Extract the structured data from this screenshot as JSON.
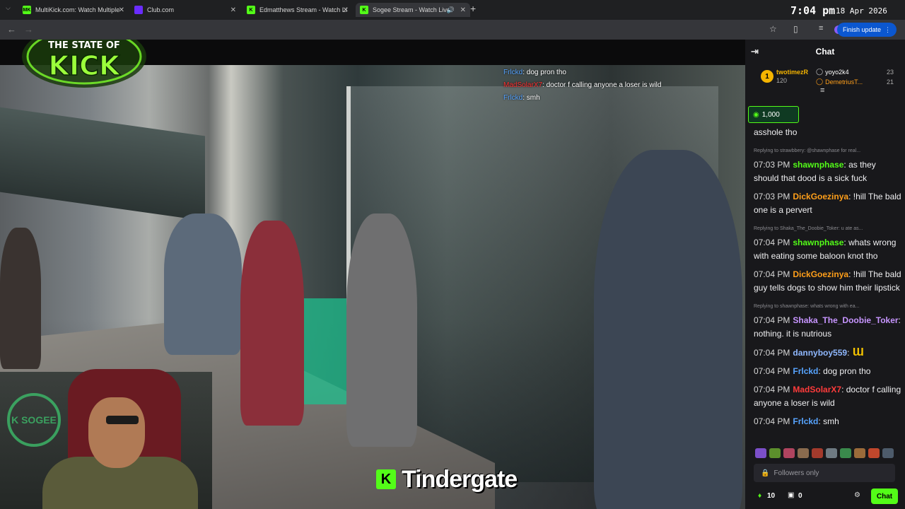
{
  "browser": {
    "tabs": [
      {
        "label": "MultiKick.com: Watch Multiple",
        "favicon": "MK"
      },
      {
        "label": "Club.com",
        "favicon": ""
      },
      {
        "label": "Edmatthews Stream - Watch Li",
        "favicon": "K"
      },
      {
        "label": "Sogee Stream - Watch Live",
        "favicon": "K"
      }
    ],
    "new_tab": "+",
    "clock": "7:04 pm",
    "date": "18 Apr 2026",
    "finish_update": "Finish update"
  },
  "stream": {
    "logo_line1": "THE STATE OF",
    "logo_line2": "KICK",
    "badge_text": "K SOGEE",
    "caption": "Tindergate",
    "caption_icon": "K",
    "overlay_chat": [
      {
        "user": "Frlckd",
        "text": ": dog pron tho"
      },
      {
        "user": "MadSolarX7",
        "text": ": doctor f calling anyone a loser is wild"
      },
      {
        "user": "Frlckd",
        "text": ": smh"
      }
    ]
  },
  "chat": {
    "title": "Chat",
    "leaderboard": [
      {
        "rank": "1",
        "name": "twotimezR",
        "value": "120"
      },
      {
        "name": "yoyo2k4",
        "value": "23"
      },
      {
        "name": "DemetriusT...",
        "value": "21"
      }
    ],
    "pinned_amount": "1,000",
    "messages": [
      {
        "reply": "",
        "time": "",
        "user": "",
        "text": "asshole tho",
        "color": "#efeff1"
      },
      {
        "reply": "Replying to strawbbery: @shawnphase for real...",
        "time": "07:03 PM",
        "user": "shawnphase",
        "text": " as they should that dood is a sick fuck",
        "color": "#53fc18"
      },
      {
        "reply": "",
        "time": "07:03 PM",
        "user": "DickGoezinya",
        "text": " !hill The bald one is a pervert",
        "color": "#ff9f1a"
      },
      {
        "reply": "Replying to Shaka_The_Doobie_Toker: u ate as...",
        "time": "07:04 PM",
        "user": "shawnphase",
        "text": " whats wrong with eating some baloon knot tho",
        "color": "#53fc18"
      },
      {
        "reply": "",
        "time": "07:04 PM",
        "user": "DickGoezinya",
        "text": " !hill The bald guy tells dogs to show him their lipstick",
        "color": "#ff9f1a"
      },
      {
        "reply": "Replying to shawnphase: whats wrong with ea...",
        "time": "07:04 PM",
        "user": "Shaka_The_Doobie_Toker",
        "text": " nothing. it is nutrious",
        "color": "#c795ff"
      },
      {
        "reply": "",
        "time": "07:04 PM",
        "user": "dannyboy559",
        "text": " Ɯ",
        "color": "#8fb8ff"
      },
      {
        "reply": "",
        "time": "07:04 PM",
        "user": "Frlckd",
        "text": " dog pron tho",
        "color": "#57a4ff"
      },
      {
        "reply": "",
        "time": "07:04 PM",
        "user": "MadSolarX7",
        "text": " doctor f calling anyone a loser is wild",
        "color": "#ff3b3b"
      },
      {
        "reply": "",
        "time": "07:04 PM",
        "user": "Frlckd",
        "text": " smh",
        "color": "#57a4ff"
      }
    ],
    "input_placeholder": "Followers only",
    "footer": {
      "points": "10",
      "gift_count": "0",
      "send_label": "Chat"
    }
  }
}
